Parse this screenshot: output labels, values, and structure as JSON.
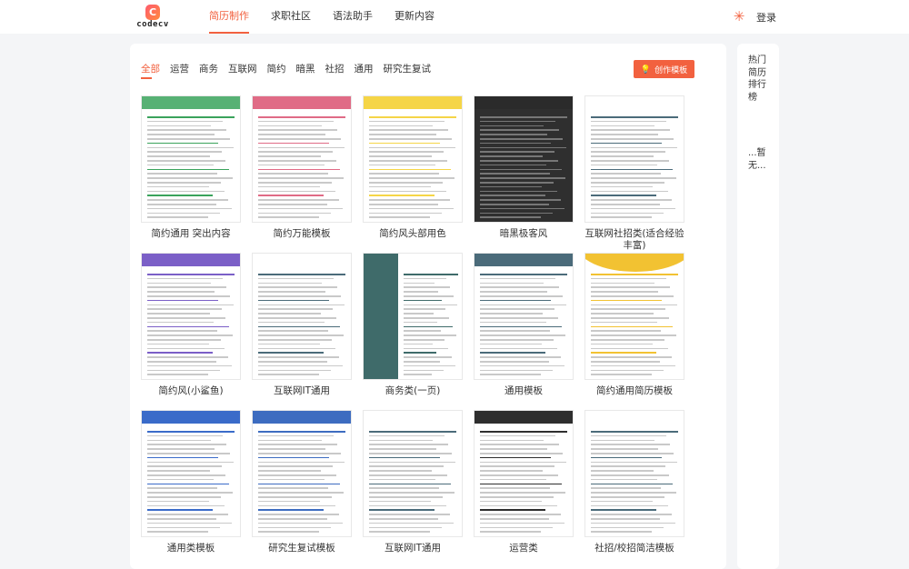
{
  "app": {
    "logo_letter": "C",
    "logo_text": "codecv"
  },
  "nav": {
    "items": [
      "简历制作",
      "求职社区",
      "语法助手",
      "更新内容"
    ],
    "active": 0,
    "login": "登录"
  },
  "filters": {
    "items": [
      "全部",
      "运营",
      "商务",
      "互联网",
      "简约",
      "暗黑",
      "社招",
      "通用",
      "研究生复试"
    ],
    "active": 0
  },
  "create_button": {
    "label": "创作模板",
    "icon": "bulb-icon"
  },
  "sidebar": {
    "title": "热门简历排行榜",
    "empty": "...暂无..."
  },
  "templates": [
    {
      "label": "简约通用 突出内容",
      "style": "green"
    },
    {
      "label": "简约万能模板",
      "style": "pink"
    },
    {
      "label": "简约风头部用色",
      "style": "yellow"
    },
    {
      "label": "暗黑极客风",
      "style": "dark"
    },
    {
      "label": "互联网社招类(适合经验丰富)",
      "style": "plain"
    },
    {
      "label": "简约风(小鲨鱼)",
      "style": "purple"
    },
    {
      "label": "互联网IT通用",
      "style": "plain"
    },
    {
      "label": "商务类(一页)",
      "style": "teal"
    },
    {
      "label": "通用模板",
      "style": "slate"
    },
    {
      "label": "简约通用简历模板",
      "style": "gold"
    },
    {
      "label": "通用类模板",
      "style": "blue"
    },
    {
      "label": "研究生复试模板",
      "style": "blue2"
    },
    {
      "label": "互联网IT通用",
      "style": "plain"
    },
    {
      "label": "运营类",
      "style": "darkhead"
    },
    {
      "label": "社招/校招简洁模板",
      "style": "plain"
    }
  ],
  "colors": {
    "accent": "#f2613f"
  }
}
